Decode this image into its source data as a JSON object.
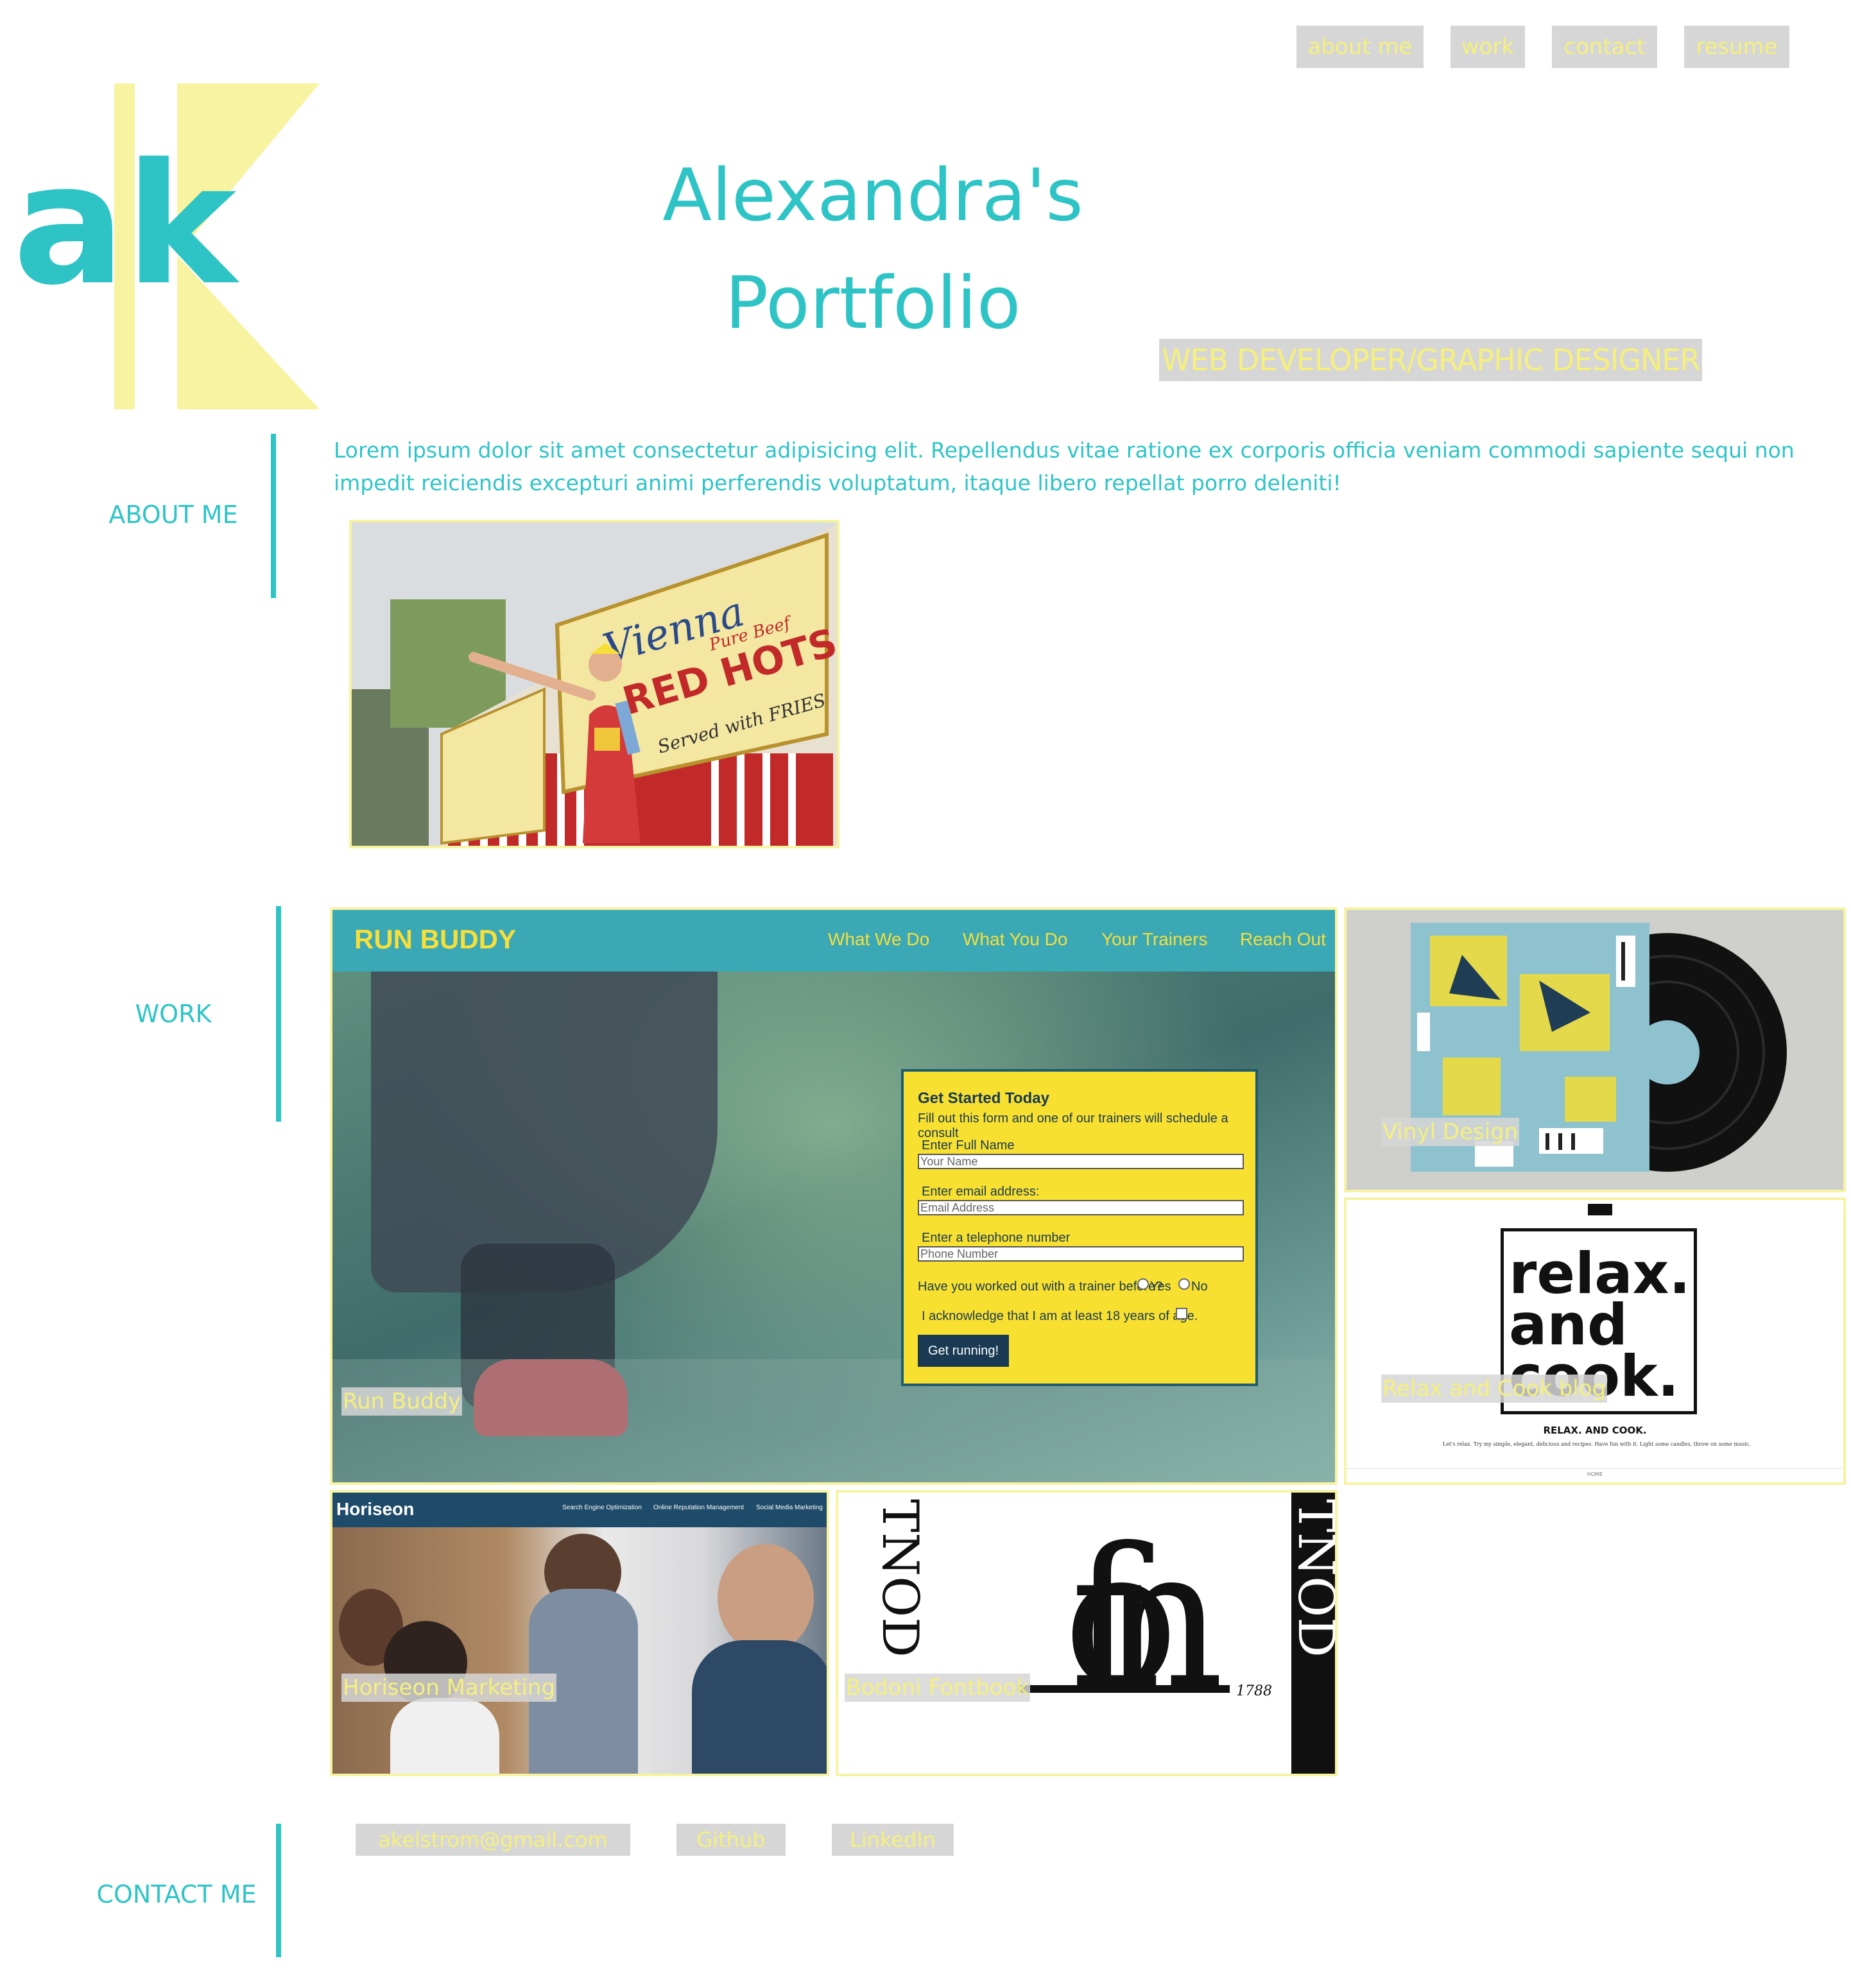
{
  "nav": {
    "items": [
      {
        "label": "about me"
      },
      {
        "label": "work"
      },
      {
        "label": "contact"
      },
      {
        "label": "resume"
      }
    ]
  },
  "logo": {
    "text": "ak"
  },
  "header": {
    "title_line1": "Alexandra's",
    "title_line2": "Portfolio",
    "subtitle": "WEB DEVELOPER/GRAPHIC DESIGNER"
  },
  "about": {
    "label": "ABOUT ME",
    "text": "Lorem ipsum dolor sit amet consectetur adipisicing elit. Repellendus vitae ratione ex corporis officia veniam commodi sapiente sequi non impedit reiciendis excepturi animi perferendis voluptatum, itaque libero repellat porro deleniti!",
    "photo_sign": {
      "line1": "Vienna",
      "line2": "Pure Beef",
      "line3": "RED HOTS",
      "line4": "Served with FRIES"
    }
  },
  "work": {
    "label": "WORK",
    "projects": [
      {
        "title": "Run Buddy"
      },
      {
        "title": "Vinyl Design"
      },
      {
        "title": "Relax and Cook blog"
      },
      {
        "title": "Horiseon Marketing"
      },
      {
        "title": "Bodoni Fontbook"
      }
    ],
    "run_buddy_screen": {
      "logo": "RUN BUDDY",
      "nav": [
        "What We Do",
        "What You Do",
        "Your Trainers",
        "Reach Out"
      ],
      "form_title": "Get Started Today",
      "form_sub": "Fill out this form and one of our trainers will schedule a consult",
      "name_label": "Enter Full Name",
      "name_placeholder": "Your Name",
      "email_label": "Enter email address:",
      "email_placeholder": "Email Address",
      "phone_label": "Enter a telephone number",
      "phone_placeholder": "Phone Number",
      "trainer_q": "Have you worked out with a trainer before?",
      "yes": "Yes",
      "no": "No",
      "ack": "I acknowledge that I am at least 18 years of age.",
      "button": "Get running!"
    },
    "relax_screen": {
      "logo_line1": "relax.",
      "logo_line2": "and",
      "logo_line3": "cook.",
      "heading": "RELAX. AND COOK.",
      "blurb": "Let's relax. Try my simple, elegant, delicious and recipes. Have fun with it. Light some candles, throw on some music, pour yourself a glass, and cook.",
      "footer": "HOME"
    },
    "horiseon_screen": {
      "logo": "Horiseon",
      "nav": [
        "Search Engine Optimization",
        "Online Reputation Management",
        "Social Media Marketing"
      ]
    },
    "bodoni_screen": {
      "year": "1788",
      "left_word": "TNOD",
      "right_word": "TNOD",
      "glyphs": "fon"
    }
  },
  "contact": {
    "label": "CONTACT ME",
    "links": [
      {
        "label": "akelstrom@gmail.com"
      },
      {
        "label": "Github"
      },
      {
        "label": "LinkedIn"
      }
    ]
  },
  "colors": {
    "teal": "#2ec4c6",
    "yellow": "#f5f07c",
    "gray": "#d6d6d6"
  }
}
